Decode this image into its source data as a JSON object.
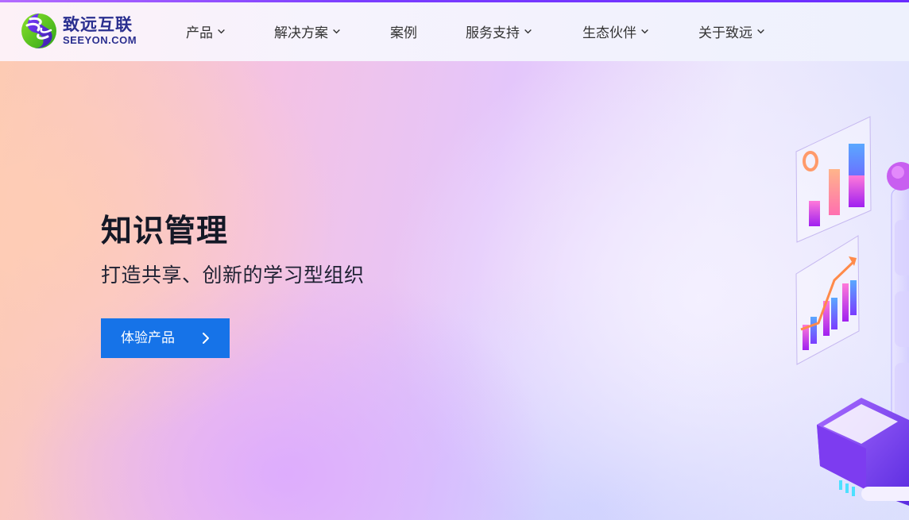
{
  "brand": {
    "name_cn": "致远互联",
    "name_en": "SEEYON.COM",
    "color_primary": "#2a2f8f",
    "color_green": "#56c21e",
    "color_purple": "#6a2cff"
  },
  "nav": {
    "items": [
      {
        "label": "产品",
        "has_dropdown": true
      },
      {
        "label": "解决方案",
        "has_dropdown": true
      },
      {
        "label": "案例",
        "has_dropdown": false
      },
      {
        "label": "服务支持",
        "has_dropdown": true
      },
      {
        "label": "生态伙伴",
        "has_dropdown": true
      },
      {
        "label": "关于致远",
        "has_dropdown": true
      }
    ],
    "dropdown_icon": "chevron-down-icon"
  },
  "hero": {
    "title": "知识管理",
    "subtitle": "打造共享、创新的学习型组织",
    "cta_label": "体验产品",
    "cta_icon": "chevron-right-icon",
    "cta_color": "#1673e8"
  }
}
